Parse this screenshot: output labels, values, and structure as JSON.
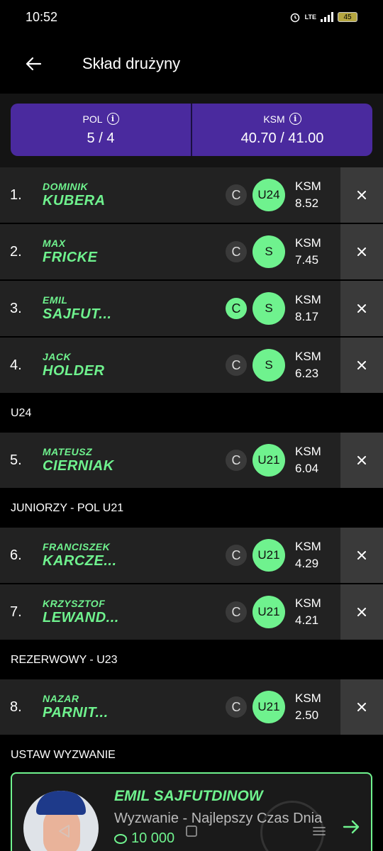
{
  "status": {
    "time": "10:52",
    "network": "LTE",
    "battery": "45"
  },
  "header": {
    "title": "Skład drużyny"
  },
  "summary": {
    "pol_label": "POL",
    "pol_value": "5 / 4",
    "ksm_label": "KSM",
    "ksm_value": "40.70 / 41.00"
  },
  "groups": [
    {
      "label": "",
      "players": [
        {
          "rank": "1.",
          "first": "DOMINIK",
          "last": "KUBERA",
          "captain": "C",
          "captain_active": false,
          "role": "U24",
          "ksm_label": "KSM",
          "ksm": "8.52"
        },
        {
          "rank": "2.",
          "first": "MAX",
          "last": "FRICKE",
          "captain": "C",
          "captain_active": false,
          "role": "S",
          "ksm_label": "KSM",
          "ksm": "7.45"
        },
        {
          "rank": "3.",
          "first": "EMIL",
          "last": "SAJFUT...",
          "captain": "C",
          "captain_active": true,
          "role": "S",
          "ksm_label": "KSM",
          "ksm": "8.17"
        },
        {
          "rank": "4.",
          "first": "JACK",
          "last": "HOLDER",
          "captain": "C",
          "captain_active": false,
          "role": "S",
          "ksm_label": "KSM",
          "ksm": "6.23"
        }
      ]
    },
    {
      "label": "U24",
      "players": [
        {
          "rank": "5.",
          "first": "MATEUSZ",
          "last": "CIERNIAK",
          "captain": "C",
          "captain_active": false,
          "role": "U21",
          "ksm_label": "KSM",
          "ksm": "6.04"
        }
      ]
    },
    {
      "label": "JUNIORZY - POL U21",
      "players": [
        {
          "rank": "6.",
          "first": "FRANCISZEK",
          "last": "KARCZE...",
          "captain": "C",
          "captain_active": false,
          "role": "U21",
          "ksm_label": "KSM",
          "ksm": "4.29"
        },
        {
          "rank": "7.",
          "first": "KRZYSZTOF",
          "last": "LEWAND...",
          "captain": "C",
          "captain_active": false,
          "role": "U21",
          "ksm_label": "KSM",
          "ksm": "4.21"
        }
      ]
    },
    {
      "label": "REZERWOWY - U23",
      "players": [
        {
          "rank": "8.",
          "first": "NAZAR",
          "last": "PARNIT...",
          "captain": "C",
          "captain_active": false,
          "role": "U21",
          "ksm_label": "KSM",
          "ksm": "2.50"
        }
      ]
    }
  ],
  "challenge": {
    "section_label": "USTAW WYZWANIE",
    "name": "EMIL SAJFUTDINOW",
    "subtitle": "Wyzwanie - Najlepszy Czas Dnia",
    "coins": "10 000"
  },
  "colors": {
    "accent": "#6ff28e",
    "summary_bg": "#4a2a9e",
    "row_bg": "#222222"
  },
  "icons": {
    "back": "arrow-left-icon",
    "info": "info-icon",
    "remove": "close-icon",
    "next": "arrow-right-icon"
  }
}
